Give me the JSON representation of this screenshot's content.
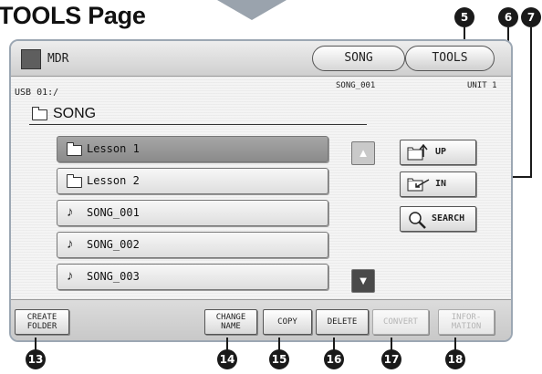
{
  "page_title": "TOOLS Page",
  "header": {
    "title": "MDR",
    "tabs": [
      "SONG",
      "TOOLS"
    ]
  },
  "location": {
    "path": "USB 01:/",
    "current_song": "SONG_001",
    "unit": "UNIT 1",
    "folder": "SONG"
  },
  "list": {
    "items": [
      {
        "label": "Lesson 1",
        "type": "folder",
        "selected": true
      },
      {
        "label": "Lesson 2",
        "type": "folder",
        "selected": false
      },
      {
        "label": "SONG_001",
        "type": "song",
        "selected": false
      },
      {
        "label": "SONG_002",
        "type": "song",
        "selected": false
      },
      {
        "label": "SONG_003",
        "type": "song",
        "selected": false
      }
    ],
    "scroll_up_icon": "triangle-up",
    "scroll_down_icon": "triangle-down"
  },
  "side_buttons": {
    "up": {
      "label": "UP",
      "icon": "folder-up-icon"
    },
    "in": {
      "label": "IN",
      "icon": "folder-in-icon"
    },
    "search": {
      "label": "SEARCH",
      "icon": "magnifier-icon"
    }
  },
  "bottom_buttons": [
    {
      "label": "CREATE\nFOLDER",
      "enabled": true
    },
    {
      "label": "CHANGE\nNAME",
      "enabled": true
    },
    {
      "label": "COPY",
      "enabled": true
    },
    {
      "label": "DELETE",
      "enabled": true
    },
    {
      "label": "CONVERT",
      "enabled": false
    },
    {
      "label": "INFOR-\nMATION",
      "enabled": false
    }
  ],
  "callouts": {
    "up": "5",
    "in": "6",
    "search": "7",
    "create_folder": "13",
    "change_name": "14",
    "copy": "15",
    "delete": "16",
    "convert": "17",
    "information": "18"
  },
  "colors": {
    "selected_item": "#959595",
    "callout": "#1a1a1a",
    "disabled_text": "#b5b5b5"
  }
}
